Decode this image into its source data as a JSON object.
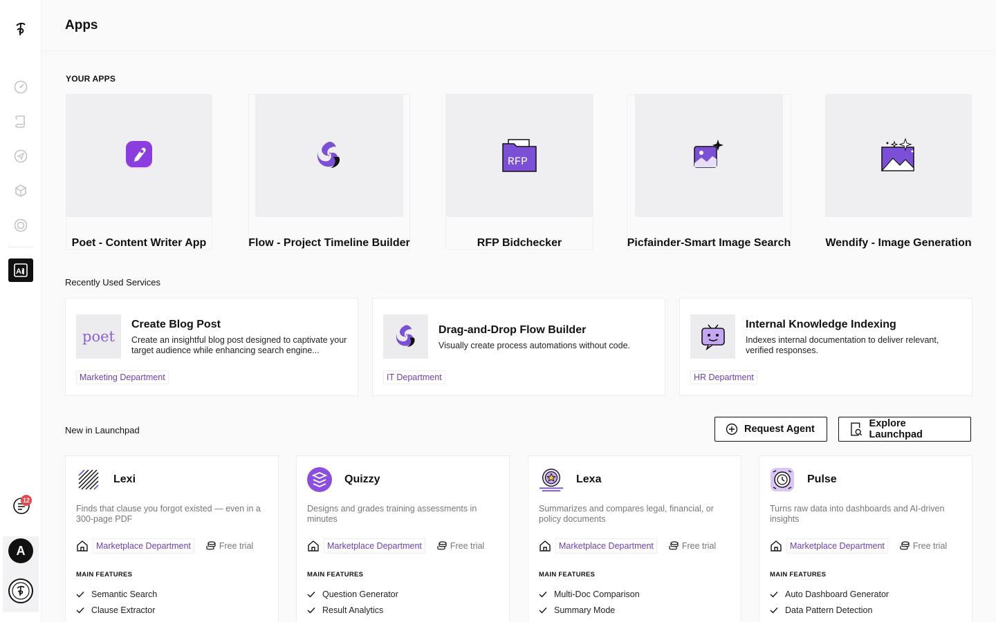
{
  "header": {
    "title": "Apps"
  },
  "sidebar": {
    "nav": [
      "dashboard-icon",
      "scroll-icon",
      "send-icon",
      "cube-icon",
      "target-icon"
    ],
    "active": "ai-apps-icon",
    "notification_count": "12",
    "avatar_initial": "A"
  },
  "your_apps": {
    "label": "YOUR APPS",
    "items": [
      {
        "name": "Poet - Content Writer App",
        "icon": "poet-app-icon"
      },
      {
        "name": "Flow - Project Timeline Builder",
        "icon": "flow-app-icon"
      },
      {
        "name": "RFP Bidchecker",
        "icon": "rfp-folder-icon",
        "icon_text": "RFP"
      },
      {
        "name": "Picfainder-Smart Image Search",
        "icon": "image-sparkle-icon"
      },
      {
        "name": "Wendify - Image Generation",
        "icon": "image-generation-icon"
      }
    ]
  },
  "recent": {
    "label": "Recently Used Services",
    "items": [
      {
        "title": "Create Blog Post",
        "desc": "Create an insightful blog post designed to captivate your target audience while enhancing search engine...",
        "dept": "Marketing Department",
        "thumb_text": "poet"
      },
      {
        "title": "Drag-and-Drop Flow Builder",
        "desc": "Visually create process automations without code.",
        "dept": "IT Department"
      },
      {
        "title": "Internal Knowledge Indexing",
        "desc": "Indexes internal documentation to deliver relevant, verified responses.",
        "dept": "HR Department"
      }
    ]
  },
  "launchpad": {
    "label": "New in Launchpad",
    "request_label": "Request Agent",
    "explore_label": "Explore Launchpad",
    "features_heading": "MAIN FEATURES",
    "items": [
      {
        "name": "Lexi",
        "desc": "Finds that clause you forgot existed — even in a 300-page PDF",
        "dept": "Marketplace Department",
        "trial": "Free trial",
        "features": [
          "Semantic Search",
          "Clause Extractor"
        ]
      },
      {
        "name": "Quizzy",
        "desc": "Designs and grades training assessments in minutes",
        "dept": "Marketplace Department",
        "trial": "Free trial",
        "features": [
          "Question Generator",
          "Result Analytics"
        ]
      },
      {
        "name": "Lexa",
        "desc": "Summarizes and compares legal, financial, or policy documents",
        "dept": "Marketplace Department",
        "trial": "Free trial",
        "features": [
          "Multi-Doc Comparison",
          "Summary Mode"
        ]
      },
      {
        "name": "Pulse",
        "desc": "Turns raw data into dashboards and AI-driven insights",
        "dept": "Marketplace Department",
        "trial": "Free trial",
        "features": [
          "Auto Dashboard Generator",
          "Data Pattern Detection"
        ]
      }
    ]
  },
  "colors": {
    "accent": "#6b3fbd",
    "purple": "#7b4fd6",
    "dark": "#111111"
  }
}
